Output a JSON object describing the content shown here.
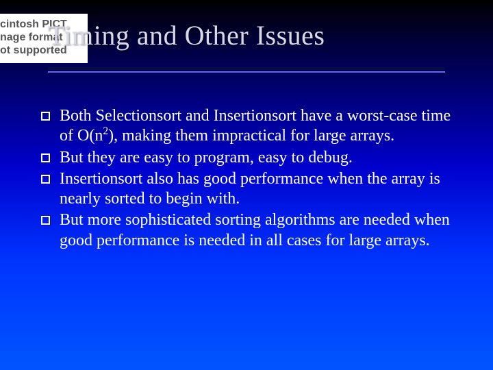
{
  "pict": {
    "line1": "cintosh PICT",
    "line2": "nage format",
    "line3": "ot supported"
  },
  "title": "Timing and Other Issues",
  "bullets": [
    {
      "pre": "Both Selectionsort and Insertionsort have a worst-case time of O(n",
      "sup": "2",
      "post": "), making them impractical for large arrays."
    },
    {
      "pre": "But they are easy to program, easy to debug.",
      "sup": "",
      "post": ""
    },
    {
      "pre": "Insertionsort also has good performance when the array is nearly sorted to begin with.",
      "sup": "",
      "post": ""
    },
    {
      "pre": "But more sophisticated sorting algorithms are needed when good performance is needed in all cases for large arrays.",
      "sup": "",
      "post": ""
    }
  ]
}
